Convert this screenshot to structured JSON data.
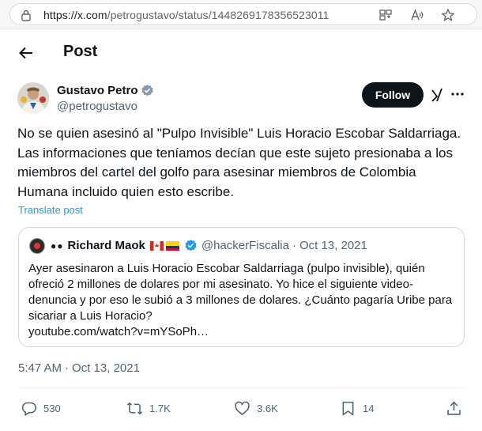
{
  "browser": {
    "url_host": "https://x.com",
    "url_path": "/petrogustavo/status/1448269178356523011"
  },
  "header": {
    "title": "Post"
  },
  "author": {
    "name": "Gustavo Petro",
    "handle": "@petrogustavo",
    "follow_label": "Follow"
  },
  "post": {
    "text": "No se quien asesinó al \"Pulpo Invisible\" Luis Horacio Escobar Saldarriaga. Las informaciones que teníamos decían que este sujeto presionaba a los miembros del cartel del golfo para asesinar miembros de Colombia Humana incluido quien esto escribe.",
    "translate_label": "Translate post"
  },
  "quote": {
    "dots": "●●",
    "name": "Richard Maok",
    "handle": "@hackerFiscalia",
    "separator": "·",
    "date": "Oct 13, 2021",
    "text": "Ayer asesinaron a Luis Horacio Escobar Saldarriaga (pulpo invisible), quién ofreció 2 millones de dolares por mi asesinato.  Yo hice el siguiente video-denuncia y por eso le subió a 3 millones de dolares. ¿Cuánto pagaría Uribe para sicariar a Luis Horacio?\nyoutube.com/watch?v=mYSoPh…"
  },
  "timestamp": {
    "time": "5:47 AM",
    "dot": "·",
    "date": "Oct 13, 2021"
  },
  "actions": {
    "replies": "530",
    "reposts": "1.7K",
    "likes": "3.6K",
    "bookmarks": "14"
  },
  "colors": {
    "accent": "#1d9bf0",
    "text": "#0f1419",
    "muted": "#536471",
    "button_bg": "#0f1419"
  },
  "icons": [
    "lock-icon",
    "tab-search-icon",
    "read-aloud-icon",
    "favorite-star-icon",
    "back-arrow-icon",
    "verified-badge-icon",
    "grok-icon",
    "more-icon",
    "reply-icon",
    "repost-icon",
    "like-icon",
    "bookmark-icon",
    "share-icon"
  ]
}
